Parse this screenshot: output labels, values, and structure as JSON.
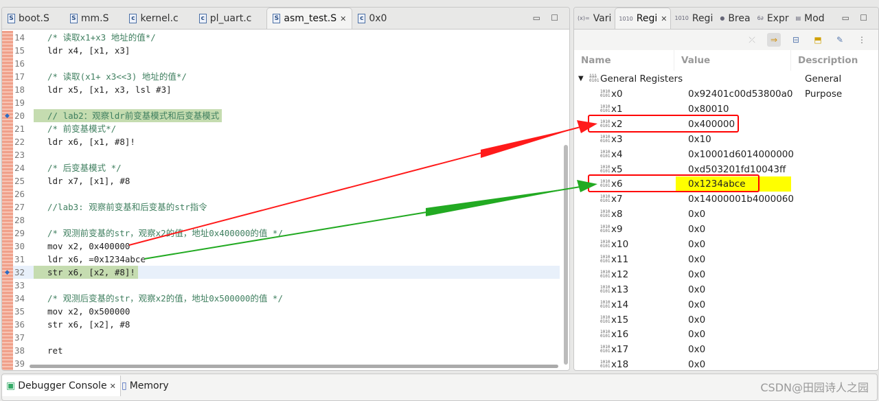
{
  "editor": {
    "tabs": [
      {
        "label": "boot.S",
        "icon": "S"
      },
      {
        "label": "mm.S",
        "icon": "S"
      },
      {
        "label": "kernel.c",
        "icon": "c"
      },
      {
        "label": "pl_uart.c",
        "icon": "c"
      },
      {
        "label": "asm_test.S",
        "icon": "S",
        "active": true
      },
      {
        "label": "0x0",
        "icon": "c"
      }
    ],
    "close_glyph": "✕",
    "lines": [
      {
        "n": "14",
        "t": "/* 读取x1+x3 地址的值*/",
        "c": true
      },
      {
        "n": "15",
        "t": "ldr x4, [x1, x3]"
      },
      {
        "n": "16",
        "t": ""
      },
      {
        "n": "17",
        "t": "/* 读取(x1+ x3<<3) 地址的值*/",
        "c": true
      },
      {
        "n": "18",
        "t": "ldr x5, [x1, x3, lsl #3]"
      },
      {
        "n": "19",
        "t": ""
      },
      {
        "n": "20",
        "t": "// lab2：观察ldr前变基模式和后变基模式",
        "c": true,
        "hl": true,
        "bp": true
      },
      {
        "n": "21",
        "t": "/* 前变基模式*/",
        "c": true
      },
      {
        "n": "22",
        "t": "ldr x6, [x1, #8]!"
      },
      {
        "n": "23",
        "t": ""
      },
      {
        "n": "24",
        "t": "/* 后变基模式 */",
        "c": true
      },
      {
        "n": "25",
        "t": "ldr x7, [x1], #8"
      },
      {
        "n": "26",
        "t": ""
      },
      {
        "n": "27",
        "t": "//lab3: 观察前变基和后变基的str指令",
        "c": true
      },
      {
        "n": "28",
        "t": ""
      },
      {
        "n": "29",
        "t": "/* 观测前变基的str，观察x2的值，地址0x400000的值 */",
        "c": true
      },
      {
        "n": "30",
        "t": "mov x2, 0x400000"
      },
      {
        "n": "31",
        "t": "ldr x6, =0x1234abce"
      },
      {
        "n": "32",
        "t": "str x6, [x2, #8]!",
        "hl": true,
        "cur": true,
        "bp": true
      },
      {
        "n": "33",
        "t": ""
      },
      {
        "n": "34",
        "t": "/* 观测后变基的str，观察x2的值，地址0x500000的值 */",
        "c": true
      },
      {
        "n": "35",
        "t": "mov x2, 0x500000"
      },
      {
        "n": "36",
        "t": "str x6, [x2], #8"
      },
      {
        "n": "37",
        "t": ""
      },
      {
        "n": "38",
        "t": "ret"
      },
      {
        "n": "39",
        "t": ""
      }
    ]
  },
  "registers_view": {
    "tabs": [
      {
        "label": "Vari",
        "icon": "(x)="
      },
      {
        "label": "Regi",
        "icon": "1010",
        "active": true
      },
      {
        "label": "Regi",
        "icon": "1010"
      },
      {
        "label": "Brea",
        "icon": "●"
      },
      {
        "label": "Expr",
        "icon": "6∂"
      },
      {
        "label": "Mod",
        "icon": "▤"
      }
    ],
    "columns": [
      "Name",
      "Value",
      "Description"
    ],
    "group": {
      "name": "General Registers",
      "description": "General Purpose"
    },
    "rows": [
      {
        "name": "x0",
        "value": "0x92401c00d53800a0"
      },
      {
        "name": "x1",
        "value": "0x80010"
      },
      {
        "name": "x2",
        "value": "0x400000",
        "boxed": true
      },
      {
        "name": "x3",
        "value": "0x10"
      },
      {
        "name": "x4",
        "value": "0x10001d6014000000"
      },
      {
        "name": "x5",
        "value": "0xd503201fd10043ff"
      },
      {
        "name": "x6",
        "value": "0x1234abce",
        "boxed": true,
        "changed": true
      },
      {
        "name": "x7",
        "value": "0x14000001b4000060"
      },
      {
        "name": "x8",
        "value": "0x0"
      },
      {
        "name": "x9",
        "value": "0x0"
      },
      {
        "name": "x10",
        "value": "0x0"
      },
      {
        "name": "x11",
        "value": "0x0"
      },
      {
        "name": "x12",
        "value": "0x0"
      },
      {
        "name": "x13",
        "value": "0x0"
      },
      {
        "name": "x14",
        "value": "0x0"
      },
      {
        "name": "x15",
        "value": "0x0"
      },
      {
        "name": "x16",
        "value": "0x0"
      },
      {
        "name": "x17",
        "value": "0x0"
      },
      {
        "name": "x18",
        "value": "0x0"
      }
    ]
  },
  "bottom": {
    "tabs": [
      {
        "label": "Debugger Console",
        "active": true
      },
      {
        "label": "Memory"
      }
    ],
    "watermark": "CSDN@田园诗人之园"
  },
  "colors": {
    "changed_highlight": "#ffff00",
    "annotation_red": "#ff0000",
    "annotation_green": "#22aa22",
    "current_line": "#c5dcb0"
  }
}
